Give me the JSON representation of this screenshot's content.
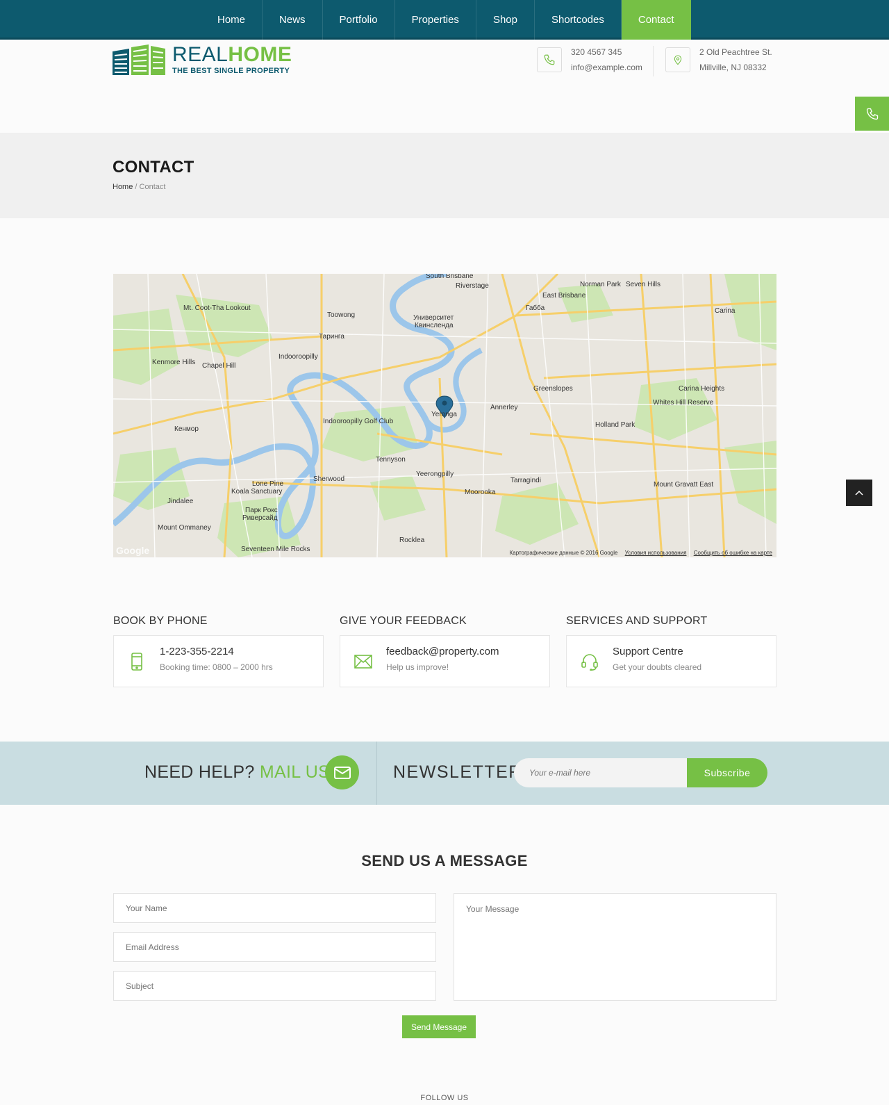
{
  "nav": {
    "items": [
      {
        "label": "Home"
      },
      {
        "label": "News"
      },
      {
        "label": "Portfolio"
      },
      {
        "label": "Properties"
      },
      {
        "label": "Shop"
      },
      {
        "label": "Shortcodes"
      },
      {
        "label": "Contact",
        "active": true
      }
    ]
  },
  "logo": {
    "title_a": "REAL",
    "title_b": "HOME",
    "tagline": "THE BEST SINGLE PROPERTY"
  },
  "header_contact": {
    "phone": "320 4567 345",
    "email": "info@example.com",
    "address_line1": "2 Old Peachtree St.",
    "address_line2": "Millville, NJ 08332"
  },
  "page": {
    "title": "CONTACT",
    "breadcrumb_home": "Home",
    "breadcrumb_sep": "/",
    "breadcrumb_current": "Contact"
  },
  "map": {
    "pin_label": "Yeronga",
    "google": "Google",
    "footer_data": "Картографические данные © 2016 Google",
    "footer_terms": "Условия использования",
    "footer_report": "Сообщить об ошибке на карте",
    "places": [
      "South Brisbane",
      "Riverstage",
      "Norman Park",
      "Seven Hills",
      "East Brisbane",
      "Mt. Coot-Tha Lookout",
      "Toowong",
      "Университет Квинсленда",
      "Габба",
      "Carina",
      "Таринга",
      "Indooroopilly",
      "Kenmore Hills",
      "Chapel Hill",
      "Greenslopes",
      "Carina Heights",
      "Annerley",
      "Indooroopilly Golf Club",
      "Holland Park",
      "Кенмор",
      "Tennyson",
      "Yeerongpilly",
      "Tarragindi",
      "Sherwood",
      "Lone Pine Koala Sanctuary",
      "Moorooka",
      "Mount Gravatt East",
      "Jindalee",
      "Парк Рокс Риверсайд",
      "Mount Ommaney",
      "Rocklea",
      "Seventeen Mile Rocks",
      "Whites Hill Reserve"
    ]
  },
  "contact_boxes": [
    {
      "heading": "BOOK BY PHONE",
      "title": "1-223-355-2214",
      "sub": "Booking time: 0800 – 2000 hrs",
      "icon": "mobile-phone-icon"
    },
    {
      "heading": "GIVE YOUR FEEDBACK",
      "title": "feedback@property.com",
      "sub": "Help us improve!",
      "icon": "envelope-icon"
    },
    {
      "heading": "SERVICES AND SUPPORT",
      "title": "Support Centre",
      "sub": "Get your doubts cleared",
      "icon": "headset-icon"
    }
  ],
  "help": {
    "text_a": "NEED HELP?",
    "text_b": "MAIL US"
  },
  "newsletter": {
    "title": "NEWSLETTER",
    "placeholder": "Your e-mail here",
    "button": "Subscribe"
  },
  "form": {
    "title": "SEND US A MESSAGE",
    "name_placeholder": "Your Name",
    "email_placeholder": "Email Address",
    "subject_placeholder": "Subject",
    "message_placeholder": "Your Message",
    "send_label": "Send Message"
  },
  "footer": {
    "follow": "FOLLOW US"
  },
  "colors": {
    "nav_bg": "#0d5a6e",
    "accent_green": "#76c045",
    "band_bg": "#c9dde1"
  }
}
